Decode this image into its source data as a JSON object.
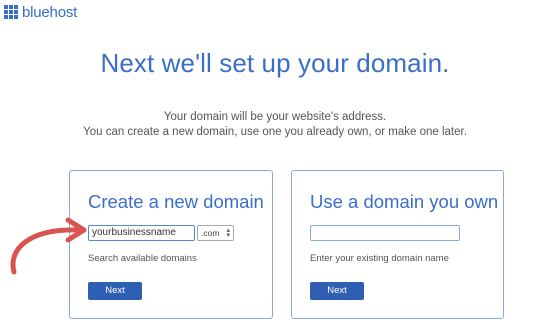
{
  "brand": {
    "name": "bluehost",
    "color": "#3a6ec8"
  },
  "headline": "Next we'll set up your domain.",
  "subtext": {
    "line1": "Your domain will be your website's address.",
    "line2": "You can create a new domain, use one you already own, or make one later."
  },
  "new_domain": {
    "title": "Create a new domain",
    "input_value": "yourbusinessname",
    "tld_selected": ".com",
    "hint": "Search available domains",
    "button": "Next"
  },
  "own_domain": {
    "title": "Use a domain you own",
    "input_value": "",
    "hint": "Enter your existing domain name",
    "button": "Next"
  },
  "colors": {
    "accent": "#3a6ec8",
    "button": "#2f5fb3",
    "annotation_arrow": "#d9534f"
  }
}
